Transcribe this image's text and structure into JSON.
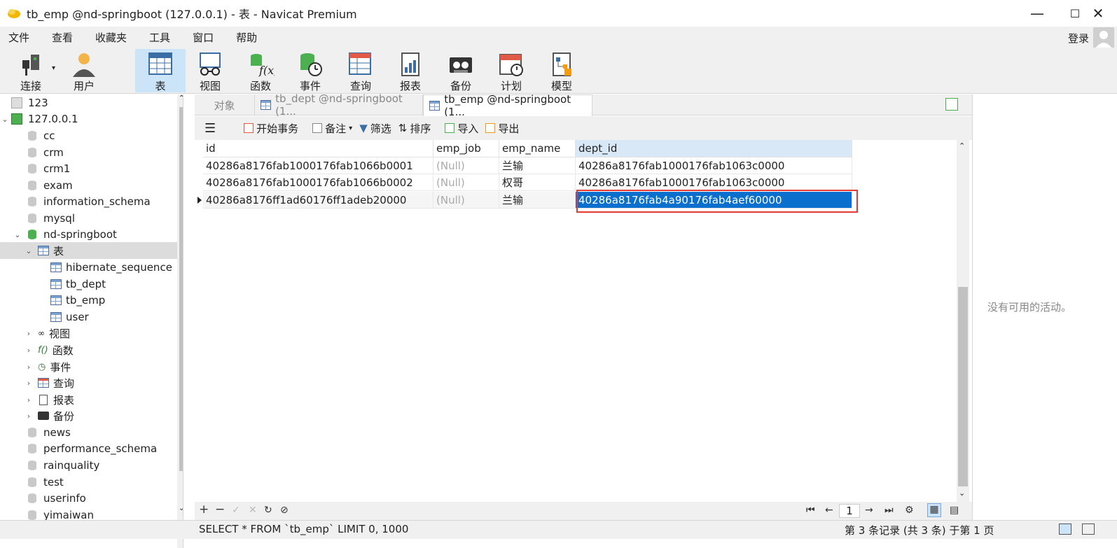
{
  "window": {
    "title": "tb_emp @nd-springboot (127.0.0.1) - 表 - Navicat Premium",
    "controls": [
      "—",
      "☐",
      "✕"
    ]
  },
  "menu": [
    "文件",
    "查看",
    "收藏夹",
    "工具",
    "窗口",
    "帮助"
  ],
  "account": {
    "login_label": "登录"
  },
  "toolbar": [
    {
      "label": "连接",
      "icon": "plug-icon"
    },
    {
      "label": "用户",
      "icon": "user-icon"
    },
    {
      "label": "表",
      "icon": "table-icon",
      "active": true
    },
    {
      "label": "视图",
      "icon": "glasses-icon"
    },
    {
      "label": "函数",
      "icon": "function-icon"
    },
    {
      "label": "事件",
      "icon": "event-clock-icon"
    },
    {
      "label": "查询",
      "icon": "query-icon"
    },
    {
      "label": "报表",
      "icon": "report-icon"
    },
    {
      "label": "备份",
      "icon": "backup-icon"
    },
    {
      "label": "计划",
      "icon": "calendar-icon"
    },
    {
      "label": "模型",
      "icon": "model-icon"
    }
  ],
  "tree": [
    {
      "label": "123"
    },
    {
      "label": "127.0.0.1"
    },
    {
      "label": "cc"
    },
    {
      "label": "crm"
    },
    {
      "label": "crm1"
    },
    {
      "label": "exam"
    },
    {
      "label": "information_schema"
    },
    {
      "label": "mysql"
    },
    {
      "label": "nd-springboot"
    },
    {
      "label": "表"
    },
    {
      "label": "hibernate_sequence"
    },
    {
      "label": "tb_dept"
    },
    {
      "label": "tb_emp"
    },
    {
      "label": "user"
    },
    {
      "label": "视图"
    },
    {
      "label": "函数"
    },
    {
      "label": "事件"
    },
    {
      "label": "查询"
    },
    {
      "label": "报表"
    },
    {
      "label": "备份"
    },
    {
      "label": "news"
    },
    {
      "label": "performance_schema"
    },
    {
      "label": "rainquality"
    },
    {
      "label": "test"
    },
    {
      "label": "userinfo"
    },
    {
      "label": "yimaiwan"
    }
  ],
  "tabs": [
    {
      "label": "对象"
    },
    {
      "label": "tb_dept @nd-springboot (1..."
    },
    {
      "label": "tb_emp @nd-springboot (1..."
    }
  ],
  "grid_toolbar": {
    "begin_txn": "开始事务",
    "note": "备注",
    "filter": "筛选",
    "sort": "排序",
    "import": "导入",
    "export": "导出"
  },
  "grid": {
    "columns": [
      "id",
      "emp_job",
      "emp_name",
      "dept_id"
    ],
    "rows": [
      [
        "40286a8176fab1000176fab1066b0001",
        "(Null)",
        "兰输",
        "40286a8176fab1000176fab1063c0000"
      ],
      [
        "40286a8176fab1000176fab1066b0002",
        "(Null)",
        "权哥",
        "40286a8176fab1000176fab1063c0000"
      ],
      [
        "40286a8176ff1ad60176ff1adeb20000",
        "(Null)",
        "兰输",
        "40286a8176fab4a90176fab4aef60000"
      ]
    ]
  },
  "pager": {
    "page": "1"
  },
  "status": {
    "sql": "SELECT * FROM `tb_emp` LIMIT 0, 1000",
    "records": "第 3 条记录 (共 3 条) 于第 1 页"
  },
  "side_panel": {
    "empty_text": "没有可用的活动。"
  }
}
